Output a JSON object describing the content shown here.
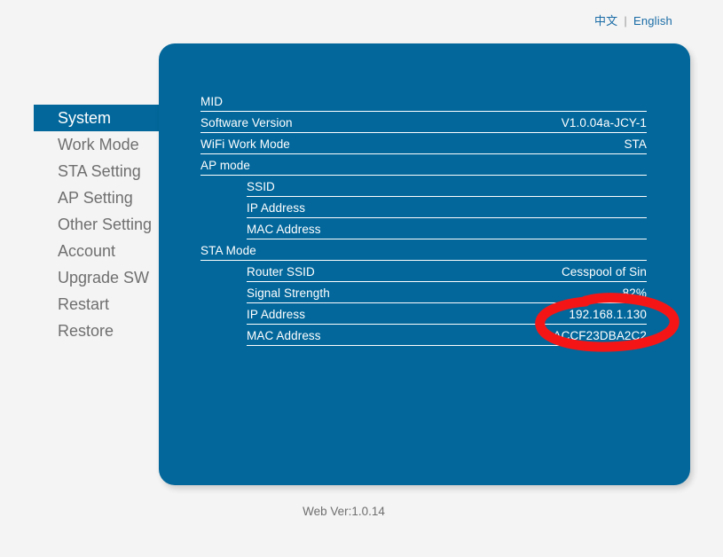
{
  "language": {
    "chinese_label": "中文",
    "separator": "|",
    "english_label": "English",
    "link_color": "#1a6ca6"
  },
  "sidebar": {
    "items": [
      {
        "label": "System",
        "active": true
      },
      {
        "label": "Work Mode",
        "active": false
      },
      {
        "label": "STA Setting",
        "active": false
      },
      {
        "label": "AP Setting",
        "active": false
      },
      {
        "label": "Other Setting",
        "active": false
      },
      {
        "label": "Account",
        "active": false
      },
      {
        "label": "Upgrade SW",
        "active": false
      },
      {
        "label": "Restart",
        "active": false
      },
      {
        "label": "Restore",
        "active": false
      }
    ],
    "active_bg": "#03679b",
    "item_color": "#6f6f6f"
  },
  "panel": {
    "background": "#03679b",
    "rows": [
      {
        "label": "MID",
        "value": "",
        "indent": false
      },
      {
        "label": "Software Version",
        "value": "V1.0.04a-JCY-1",
        "indent": false
      },
      {
        "label": "WiFi Work Mode",
        "value": "STA",
        "indent": false
      },
      {
        "label": "AP mode",
        "value": "",
        "indent": false
      },
      {
        "label": "SSID",
        "value": "",
        "indent": true
      },
      {
        "label": "IP Address",
        "value": "",
        "indent": true
      },
      {
        "label": "MAC Address",
        "value": "",
        "indent": true
      },
      {
        "label": "STA Mode",
        "value": "",
        "indent": false
      },
      {
        "label": "Router SSID",
        "value": "Cesspool of Sin",
        "indent": true
      },
      {
        "label": "Signal Strength",
        "value": "82%",
        "indent": true
      },
      {
        "label": "IP Address",
        "value": "192.168.1.130",
        "indent": true
      },
      {
        "label": "MAC Address",
        "value": "ACCF23DBA2C2",
        "indent": true
      }
    ]
  },
  "annotation": {
    "shape": "hand-drawn-red-ellipse",
    "color": "#f41616",
    "highlights": "192.168.1.130"
  },
  "footer": {
    "web_version_label": "Web Ver:1.0.14"
  }
}
